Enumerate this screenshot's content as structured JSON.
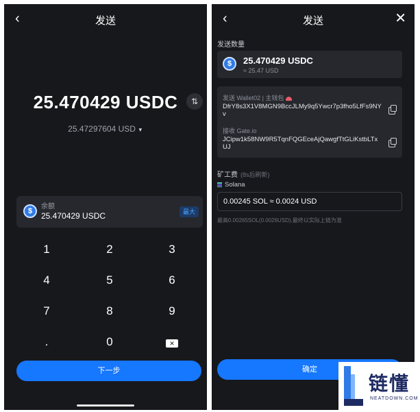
{
  "left": {
    "title": "发送",
    "back_glyph": "‹",
    "amount": "25.470429 USDC",
    "swap_glyph": "⇅",
    "fiat": "25.47297604 USD",
    "fiat_caret": "▼",
    "balance_label": "余额",
    "balance_amount": "25.470429 USDC",
    "max_label": "最大",
    "coin_glyph": "$",
    "keys": [
      "1",
      "2",
      "3",
      "4",
      "5",
      "6",
      "7",
      "8",
      "9",
      ".",
      "0",
      "⌫"
    ],
    "next_label": "下一步"
  },
  "right": {
    "title": "发送",
    "back_glyph": "‹",
    "close_glyph": "✕",
    "amount_section_label": "发送数量",
    "amount": "25.470429 USDC",
    "amount_fiat": "≈ 25.47 USD",
    "from_label": "发送 Wallet02 | 主钱包",
    "from_address": "DfrY8s3X1V8MGN9BccJLMy9q5Ywcr7p3fho5LfFs9NYv",
    "to_label": "接收 Gate.io",
    "to_address": "JCipw1k58NW9R5TqnFQGEceAjQawgfTtGLiKstbLTxUJ",
    "fee_label": "矿工费",
    "fee_refresh": "(8s后刷新)",
    "chain_name": "Solana",
    "fee_value": "0.00245 SOL ≈ 0.0024 USD",
    "fee_note": "最高0.00265SOL(0.0026USD),最终以实际上链为准",
    "confirm_label": "确定"
  },
  "watermark": {
    "cn": "链懂",
    "en": "NEATDOWN.COM"
  },
  "colors": {
    "background": "#17181c",
    "card": "#26282e",
    "accent": "#1677ff",
    "usdc": "#2f7be8"
  },
  "icons": [
    "back-icon",
    "close-icon",
    "swap-icon",
    "usdc-coin-icon",
    "copy-icon",
    "backspace-icon",
    "solana-icon"
  ]
}
